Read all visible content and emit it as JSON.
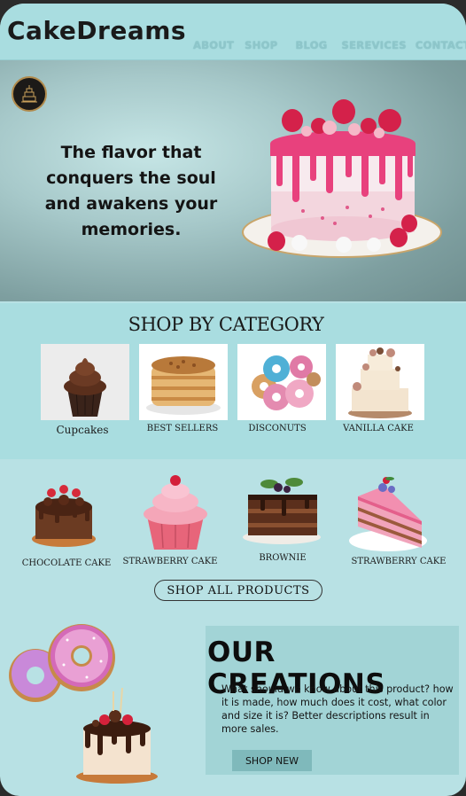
{
  "brand": {
    "logo": "CakeDreams"
  },
  "nav": {
    "items": [
      "ABOUT",
      "SHOP",
      "BLOG",
      "SEREVICES",
      "CONTACT"
    ]
  },
  "hero": {
    "tagline": "The flavor that conquers the soul and awakens your memories."
  },
  "category": {
    "title": "SHOP BY CATEGORY",
    "items": [
      "Cupcakes",
      "BEST SELLERS",
      "DISCONUTS",
      "VANILLA CAKE"
    ]
  },
  "products": {
    "items": [
      "CHOCOLATE CAKE",
      "STRAWBERRY CAKE",
      "BROWNIE",
      "STRAWBERRY CAKE"
    ],
    "cta": "SHOP ALL PRODUCTS"
  },
  "creations": {
    "title": "OUR CREATIONS",
    "description": "What should we know about this product? how it is made, how much does it cost, what color and size it is? Better descriptions result in more sales.",
    "cta": "SHOP NEW"
  },
  "colors": {
    "background": "#b8e1e4",
    "header": "#a9dde0",
    "nav_text": "#8ec6ca",
    "button": "#7fb9bb"
  }
}
